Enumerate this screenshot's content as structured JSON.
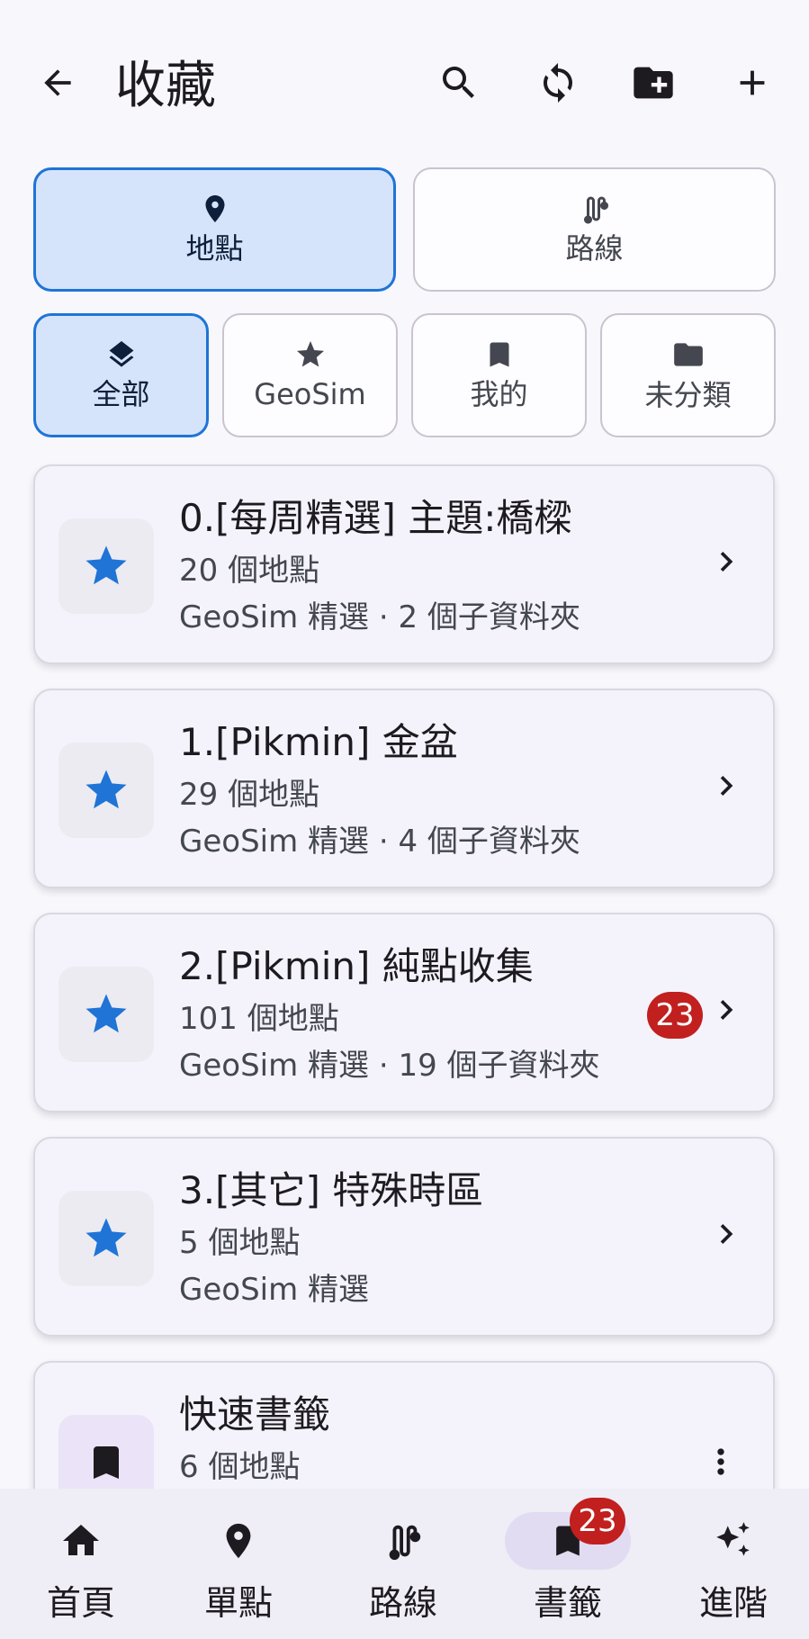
{
  "header": {
    "title": "收藏"
  },
  "type_tabs": [
    {
      "label": "地點",
      "icon": "location-pin-icon",
      "active": true
    },
    {
      "label": "路線",
      "icon": "route-icon",
      "active": false
    }
  ],
  "filter_tabs": [
    {
      "label": "全部",
      "icon": "layers-icon",
      "active": true
    },
    {
      "label": "GeoSim",
      "icon": "star-icon",
      "active": false
    },
    {
      "label": "我的",
      "icon": "bookmark-icon",
      "active": false
    },
    {
      "label": "未分類",
      "icon": "folder-icon",
      "active": false
    }
  ],
  "folders": [
    {
      "title": "0.[每周精選] 主題:橋樑",
      "count": "20 個地點",
      "meta": "GeoSim 精選 · 2 個子資料夾",
      "icon": "star-icon"
    },
    {
      "title": "1.[Pikmin] 金盆",
      "count": "29 個地點",
      "meta": "GeoSim 精選 · 4 個子資料夾",
      "icon": "star-icon"
    },
    {
      "title": "2.[Pikmin] 純點收集",
      "count": "101 個地點",
      "meta": "GeoSim 精選 · 19 個子資料夾",
      "badge": "23",
      "icon": "star-icon"
    },
    {
      "title": "3.[其它] 特殊時區",
      "count": "5 個地點",
      "meta": "GeoSim 精選",
      "icon": "star-icon"
    },
    {
      "title": "快速書籤",
      "count": "6 個地點",
      "icon": "bookmark-icon"
    }
  ],
  "bottom_nav": [
    {
      "label": "首頁",
      "icon": "home-icon"
    },
    {
      "label": "單點",
      "icon": "location-pin-icon"
    },
    {
      "label": "路線",
      "icon": "route-icon"
    },
    {
      "label": "書籤",
      "icon": "bookmark-icon",
      "badge": "23",
      "active": true
    },
    {
      "label": "進階",
      "icon": "sparkle-icon"
    }
  ],
  "colors": {
    "accent": "#1f74d6",
    "badge": "#c21f1f",
    "active_tab_bg": "#d6e4fb"
  }
}
